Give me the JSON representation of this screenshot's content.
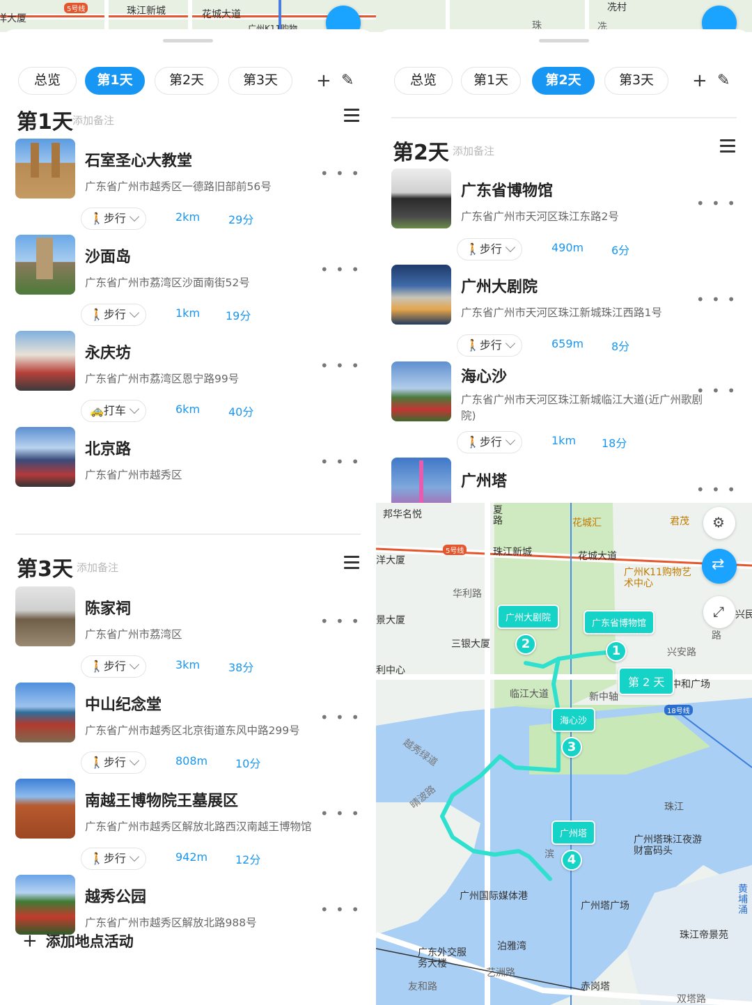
{
  "left_panel": {
    "tabs": [
      "总览",
      "第1天",
      "第2天",
      "第3天"
    ],
    "active_tab": 1,
    "day1": {
      "title": "第1天",
      "note": "添加备注",
      "pois": [
        {
          "name": "石室圣心大教堂",
          "address": "广东省广州市越秀区一德路旧部前56号"
        },
        {
          "name": "沙面岛",
          "address": "广东省广州市荔湾区沙面南街52号"
        },
        {
          "name": "永庆坊",
          "address": "广东省广州市荔湾区恩宁路99号"
        },
        {
          "name": "北京路",
          "address": "广东省广州市越秀区"
        }
      ],
      "transports": [
        {
          "mode": "步行",
          "distance": "2km",
          "duration": "29分"
        },
        {
          "mode": "步行",
          "distance": "1km",
          "duration": "19分"
        },
        {
          "mode": "打车",
          "distance": "6km",
          "duration": "40分"
        }
      ]
    },
    "day3": {
      "title": "第3天",
      "note": "添加备注",
      "pois": [
        {
          "name": "陈家祠",
          "address": "广东省广州市荔湾区"
        },
        {
          "name": "中山纪念堂",
          "address": "广东省广州市越秀区北京街道东风中路299号"
        },
        {
          "name": "南越王博物院王墓展区",
          "address": "广东省广州市越秀区解放北路西汉南越王博物馆"
        },
        {
          "name": "越秀公园",
          "address": "广东省广州市越秀区解放北路988号"
        }
      ],
      "transports": [
        {
          "mode": "步行",
          "distance": "3km",
          "duration": "38分"
        },
        {
          "mode": "步行",
          "distance": "808m",
          "duration": "10分"
        },
        {
          "mode": "步行",
          "distance": "942m",
          "duration": "12分"
        }
      ]
    },
    "add_label": "添加地点活动"
  },
  "right_panel": {
    "tabs": [
      "总览",
      "第1天",
      "第2天",
      "第3天"
    ],
    "active_tab": 2,
    "day2": {
      "title": "第2天",
      "note": "添加备注",
      "pois": [
        {
          "name": "广东省博物馆",
          "address": "广东省广州市天河区珠江东路2号"
        },
        {
          "name": "广州大剧院",
          "address": "广东省广州市天河区珠江新城珠江西路1号"
        },
        {
          "name": "海心沙",
          "address": "广东省广州市天河区珠江新城临江大道(近广州歌剧院)"
        },
        {
          "name": "广州塔",
          "address": ""
        }
      ],
      "transports": [
        {
          "mode": "步行",
          "distance": "490m",
          "duration": "6分"
        },
        {
          "mode": "步行",
          "distance": "659m",
          "duration": "8分"
        },
        {
          "mode": "步行",
          "distance": "1km",
          "duration": "18分"
        }
      ]
    }
  },
  "top_map_left": {
    "labels": [
      "洋大厦",
      "5号线",
      "珠江新城",
      "花城大道",
      "广州K11购物"
    ]
  },
  "top_map_right": {
    "labels": [
      "冼村",
      "珠",
      "冼"
    ]
  },
  "map": {
    "labels": [
      "邦华名悦",
      "夏路",
      "花城汇",
      "君茂",
      "洋大厦",
      "5号线",
      "珠江新城",
      "花城大道",
      "广州K11购物艺术中心",
      "华利路",
      "景大厦",
      "三银大厦",
      "兴安路",
      "利中心",
      "临江大道",
      "新中轴",
      "中和广场",
      "18号线",
      "越秀绿道",
      "晴波路",
      "珠江",
      "广州塔珠江夜游财富码头",
      "滨",
      "广州国际媒体港",
      "广州塔广场",
      "黄埔涌",
      "珠江帝景苑",
      "泊雅湾",
      "广东外交服务大楼",
      "艺洲路",
      "友和路",
      "赤岗塔",
      "双塔路",
      "路",
      "兴民"
    ],
    "bubbles": [
      "广州大剧院",
      "广东省博物馆",
      "海心沙",
      "广州塔"
    ],
    "day_label": "第 2 天",
    "pins": [
      "1",
      "2",
      "3",
      "4"
    ],
    "route_color": "#2fe0cf",
    "river_color": "#a9cff5",
    "park_color": "#c9e8b8"
  },
  "colors": {
    "accent": "#1896f3",
    "teal": "#16d3c7"
  }
}
